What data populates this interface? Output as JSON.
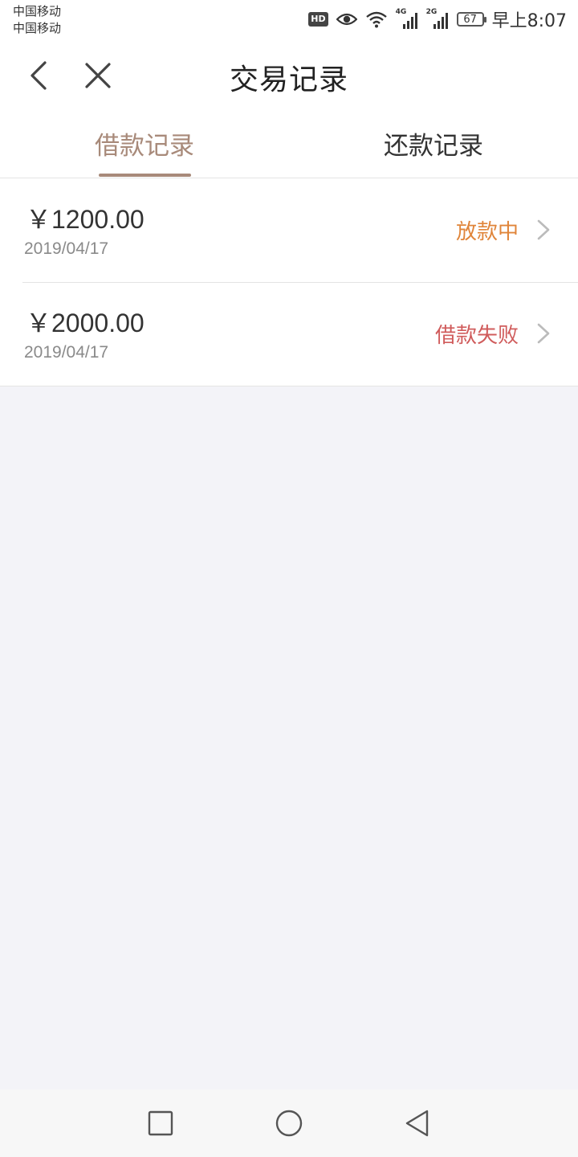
{
  "status_bar": {
    "carrier_1": "中国移动",
    "carrier_2": "中国移动",
    "hd_label": "HD",
    "network_1": "4G",
    "network_2": "2G",
    "battery_level": "67",
    "time": "早上8:07",
    "icons": [
      "hd-icon",
      "eye-icon",
      "wifi-icon",
      "signal-icon",
      "signal-icon",
      "battery-icon"
    ]
  },
  "nav": {
    "title": "交易记录",
    "back_icon": "chevron-left-icon",
    "close_icon": "close-icon"
  },
  "tabs": {
    "items": [
      {
        "label": "借款记录",
        "active": true
      },
      {
        "label": "还款记录",
        "active": false
      }
    ],
    "active_color": "#a88a7a"
  },
  "records": [
    {
      "amount": "￥1200.00",
      "date": "2019/04/17",
      "status": "放款中",
      "status_color": "#e0853a"
    },
    {
      "amount": "￥2000.00",
      "date": "2019/04/17",
      "status": "借款失败",
      "status_color": "#d05c5c"
    }
  ],
  "system_nav": {
    "icons": [
      "square-recent-icon",
      "circle-home-icon",
      "triangle-back-icon"
    ]
  },
  "colors": {
    "background": "#f3f3f8",
    "surface": "#ffffff",
    "divider": "#e4e4e4"
  }
}
